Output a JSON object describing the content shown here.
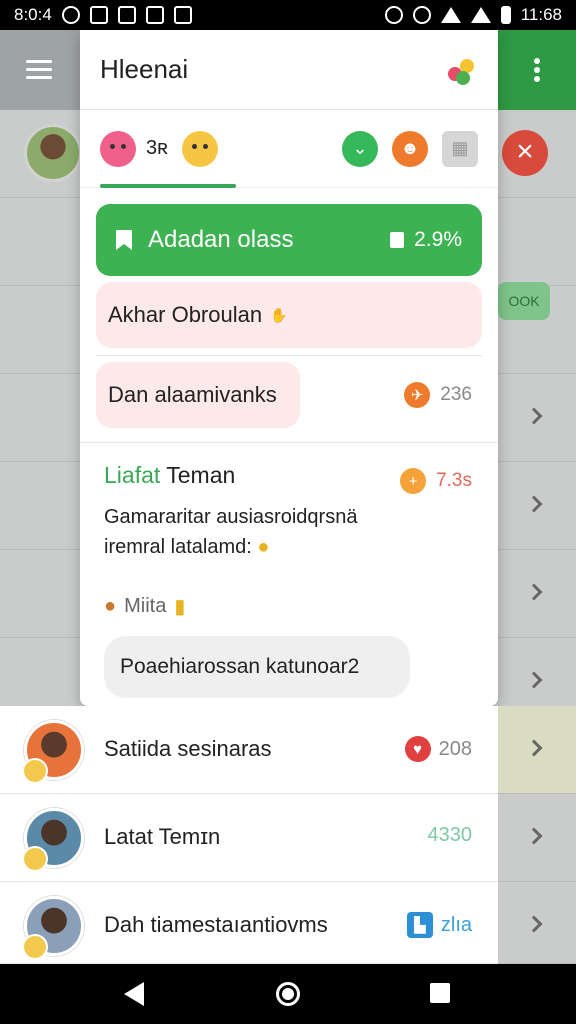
{
  "status_bar": {
    "time_left": "8:0:4",
    "time_right": "11:68"
  },
  "drawer": {
    "title": "Hleenai",
    "tabs": {
      "count": "3ʀ"
    },
    "hero": {
      "label": "Adadan olass",
      "percent": "2.9%"
    },
    "pink_row_1": {
      "text": "Akhar Obroulan"
    },
    "pink_row_2": {
      "text": "Dan alaamivanks",
      "count": "236"
    },
    "message": {
      "title_part1": "Liafat",
      "title_part2": "Teman",
      "count": "7.3s",
      "body": "Gamararitar ausiasroidqrsnä iremral latalamd:",
      "sender": "Miita",
      "reply": "Poaehiarossan katunoar2"
    }
  },
  "list": [
    {
      "name": "Satiida sesinaras",
      "meta": "208"
    },
    {
      "name": "Latat Temɪn",
      "meta": "4330"
    },
    {
      "name": "Dah tiamestaıantiovms",
      "meta": "zlıa"
    }
  ],
  "background": {
    "green_pill": "OOK"
  }
}
